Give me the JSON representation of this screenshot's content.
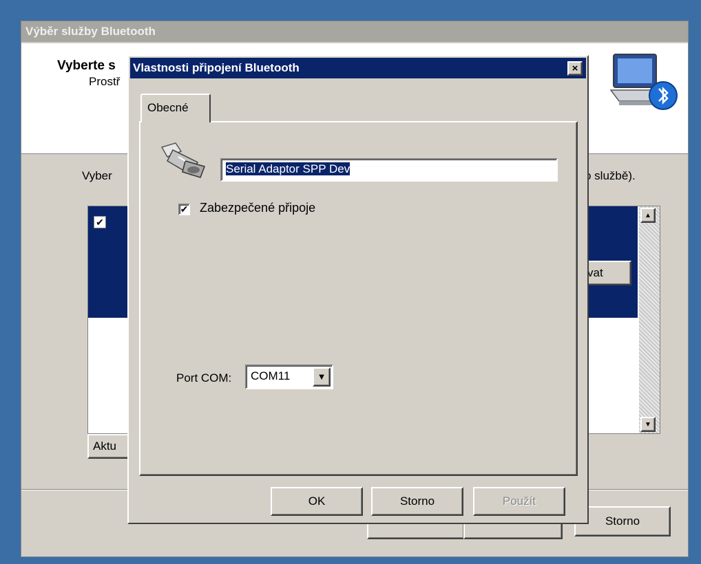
{
  "background_window": {
    "title": "Výběr služby Bluetooth",
    "heading": "Vyberte s",
    "subheading": "Prostř",
    "subheading_tail": ".",
    "prompt": "Vyber",
    "prompt_tail": "o službě).",
    "configure_button": "vat",
    "refresh_button": "Aktu",
    "back_button": "",
    "next_button": "",
    "cancel_button": "Storno"
  },
  "dialog": {
    "title": "Vlastnosti připojení Bluetooth",
    "close_label": "×",
    "tab": "Obecné",
    "name_value": "Serial Adaptor SPP Dev",
    "secure_checkbox_label": "Zabezpečené připoje",
    "secure_checked": true,
    "port_label": "Port COM:",
    "port_value": "COM11",
    "ok_button": "OK",
    "cancel_button": "Storno",
    "apply_button": "Použít"
  },
  "icons": {
    "bluetooth_computer": "computer-bluetooth-icon",
    "serial_plug": "serial-plug-icon",
    "dropdown_arrow": "▼",
    "check_glyph": "✔"
  },
  "colors": {
    "desktop": "#3a6ea5",
    "face": "#d4d0c8",
    "title_active": "#0a246a",
    "title_inactive": "#a8a6a0",
    "selection": "#0a246a"
  }
}
